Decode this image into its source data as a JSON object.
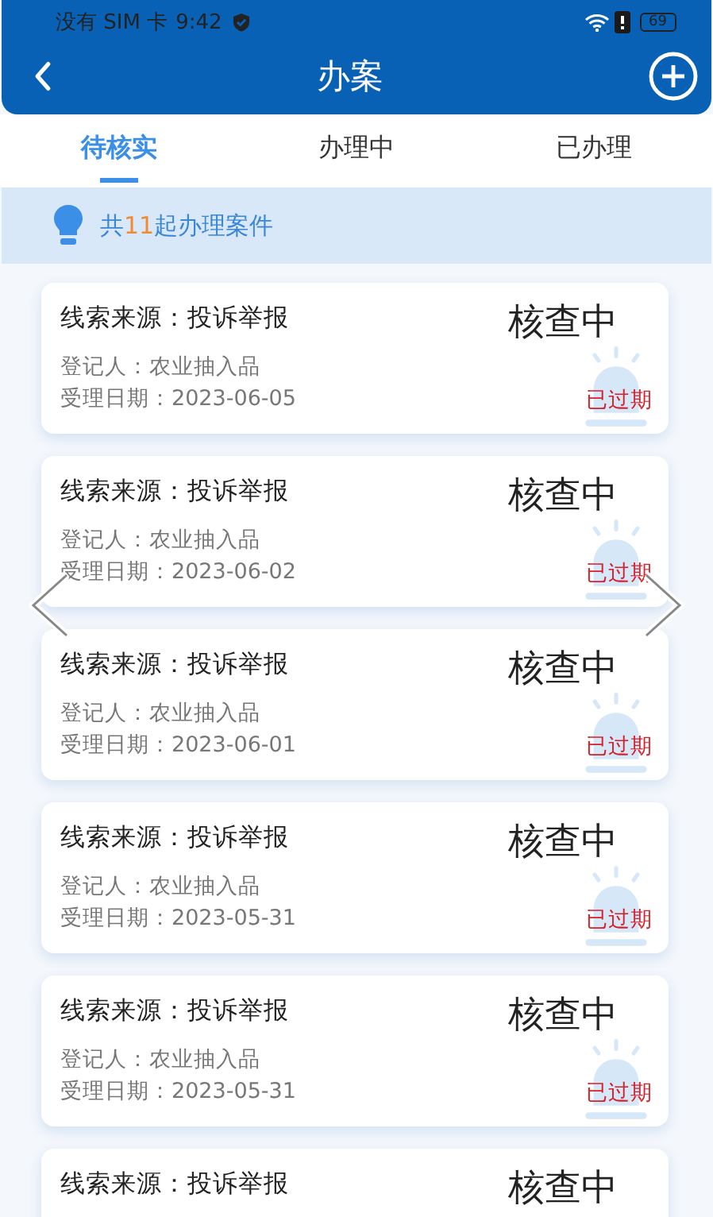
{
  "status_bar": {
    "carrier": "没有 SIM 卡",
    "time": "9:42",
    "battery": "69"
  },
  "header": {
    "title": "办案"
  },
  "tabs": [
    {
      "label": "待核实",
      "selected": true
    },
    {
      "label": "办理中",
      "selected": false
    },
    {
      "label": "已办理",
      "selected": false
    }
  ],
  "summary": {
    "prefix": "共",
    "count": "11",
    "suffix": "起办理案件"
  },
  "cases": [
    {
      "source": "线索来源：投诉举报",
      "registrant": "登记人：农业抽入品",
      "date": "受理日期：2023-06-05",
      "status": "核查中",
      "flag": "已过期"
    },
    {
      "source": "线索来源：投诉举报",
      "registrant": "登记人：农业抽入品",
      "date": "受理日期：2023-06-02",
      "status": "核查中",
      "flag": "已过期"
    },
    {
      "source": "线索来源：投诉举报",
      "registrant": "登记人：农业抽入品",
      "date": "受理日期：2023-06-01",
      "status": "核查中",
      "flag": "已过期"
    },
    {
      "source": "线索来源：投诉举报",
      "registrant": "登记人：农业抽入品",
      "date": "受理日期：2023-05-31",
      "status": "核查中",
      "flag": "已过期"
    },
    {
      "source": "线索来源：投诉举报",
      "registrant": "登记人：农业抽入品",
      "date": "受理日期：2023-05-31",
      "status": "核查中",
      "flag": "已过期"
    },
    {
      "source": "线索来源：投诉举报",
      "status": "核查中"
    }
  ]
}
